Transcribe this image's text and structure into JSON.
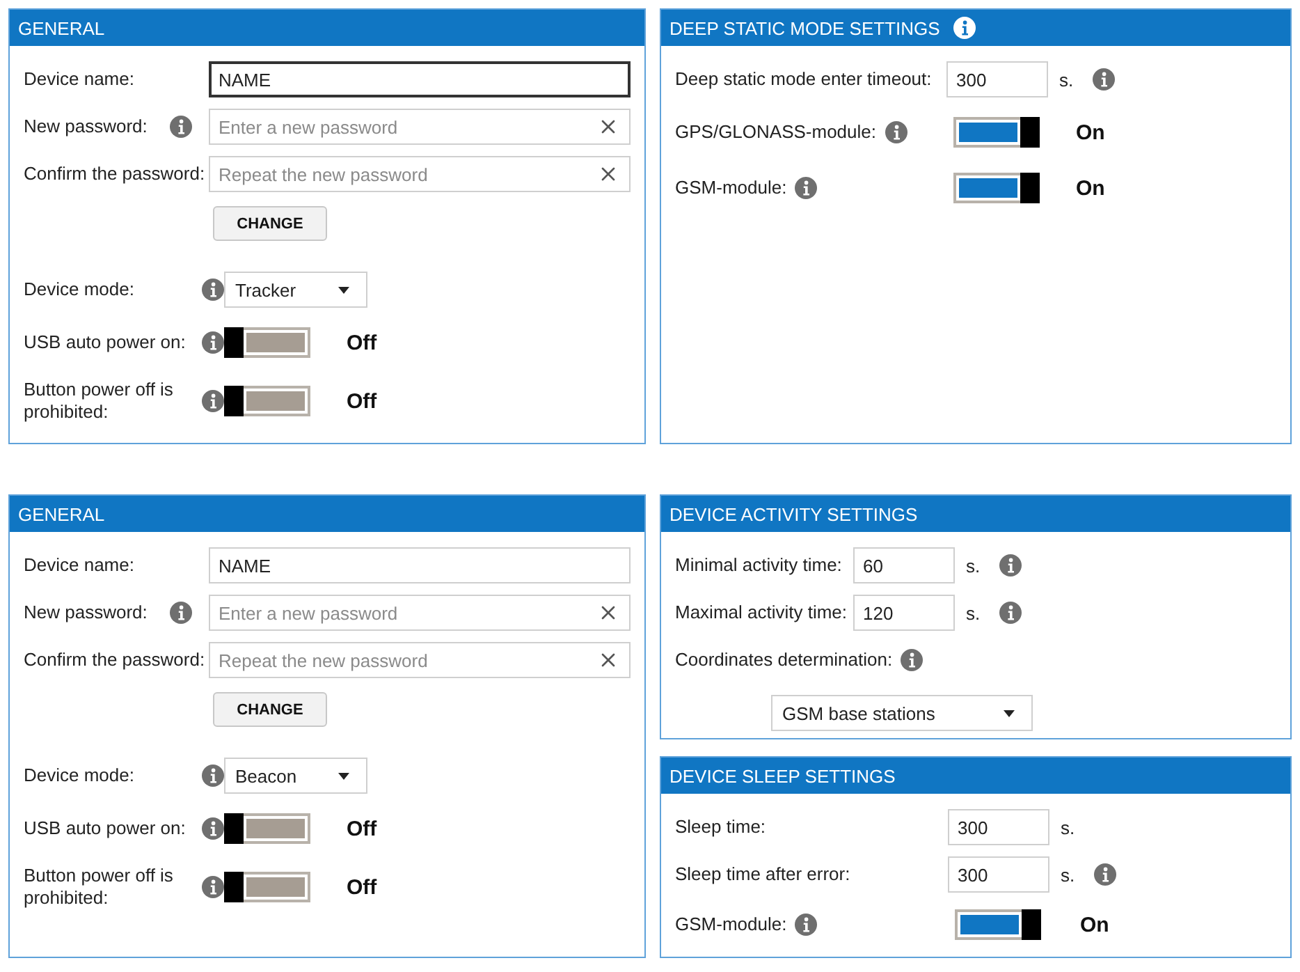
{
  "blocks": [
    {
      "left": {
        "kind": "general",
        "title": "GENERAL",
        "info": false,
        "rows": [
          {
            "kind": "text",
            "label": "Device name:",
            "value": "NAME",
            "focused": true,
            "info": false
          },
          {
            "kind": "password",
            "label": "New password:",
            "placeholder": "Enter a new password",
            "info": true
          },
          {
            "kind": "password",
            "label": "Confirm the password:",
            "placeholder": "Repeat the new password",
            "info": false
          },
          {
            "kind": "button",
            "label": "CHANGE"
          },
          {
            "kind": "select",
            "label": "Device mode:",
            "value": "Tracker",
            "info": true
          },
          {
            "kind": "toggle",
            "label": "USB auto power on:",
            "on": false,
            "status": "Off",
            "info": true
          },
          {
            "kind": "toggle",
            "label": "Button power off is prohibited:",
            "on": false,
            "status": "Off",
            "info": true
          }
        ]
      },
      "right": [
        {
          "kind": "deep_static",
          "title": "DEEP STATIC MODE SETTINGS",
          "info": true,
          "rows": [
            {
              "kind": "number",
              "label": "Deep static mode enter timeout:",
              "value": "300",
              "unit": "s.",
              "info": true
            },
            {
              "kind": "toggle",
              "label": "GPS/GLONASS-module:",
              "on": true,
              "status": "On",
              "info": true
            },
            {
              "kind": "toggle",
              "label": "GSM-module:",
              "on": true,
              "status": "On",
              "info": true
            }
          ]
        }
      ]
    },
    {
      "left": {
        "kind": "general",
        "title": "GENERAL",
        "info": false,
        "rows": [
          {
            "kind": "text",
            "label": "Device name:",
            "value": "NAME",
            "focused": false,
            "info": false
          },
          {
            "kind": "password",
            "label": "New password:",
            "placeholder": "Enter a new password",
            "info": true
          },
          {
            "kind": "password",
            "label": "Confirm the password:",
            "placeholder": "Repeat the new password",
            "info": false
          },
          {
            "kind": "button",
            "label": "CHANGE"
          },
          {
            "kind": "select",
            "label": "Device mode:",
            "value": "Beacon",
            "info": true
          },
          {
            "kind": "toggle",
            "label": "USB auto power on:",
            "on": false,
            "status": "Off",
            "info": true
          },
          {
            "kind": "toggle",
            "label": "Button power off is prohibited:",
            "on": false,
            "status": "Off",
            "info": true
          }
        ]
      },
      "right": [
        {
          "kind": "activity",
          "title": "DEVICE ACTIVITY SETTINGS",
          "info": false,
          "rows": [
            {
              "kind": "number",
              "label": "Minimal activity time:",
              "value": "60",
              "unit": "s.",
              "info": true
            },
            {
              "kind": "number",
              "label": "Maximal activity time:",
              "value": "120",
              "unit": "s.",
              "info": true
            },
            {
              "kind": "heading",
              "label": "Coordinates determination:",
              "info": true
            },
            {
              "kind": "wide_select",
              "value": "GSM base stations"
            }
          ]
        },
        {
          "kind": "sleep",
          "title": "DEVICE SLEEP SETTINGS",
          "info": false,
          "rows": [
            {
              "kind": "number",
              "label": "Sleep time:",
              "value": "300",
              "unit": "s.",
              "info": false
            },
            {
              "kind": "number",
              "label": "Sleep time after error:",
              "value": "300",
              "unit": "s.",
              "info": true
            },
            {
              "kind": "toggle",
              "label": "GSM-module:",
              "on": true,
              "status": "On",
              "info": true
            }
          ]
        }
      ]
    }
  ]
}
